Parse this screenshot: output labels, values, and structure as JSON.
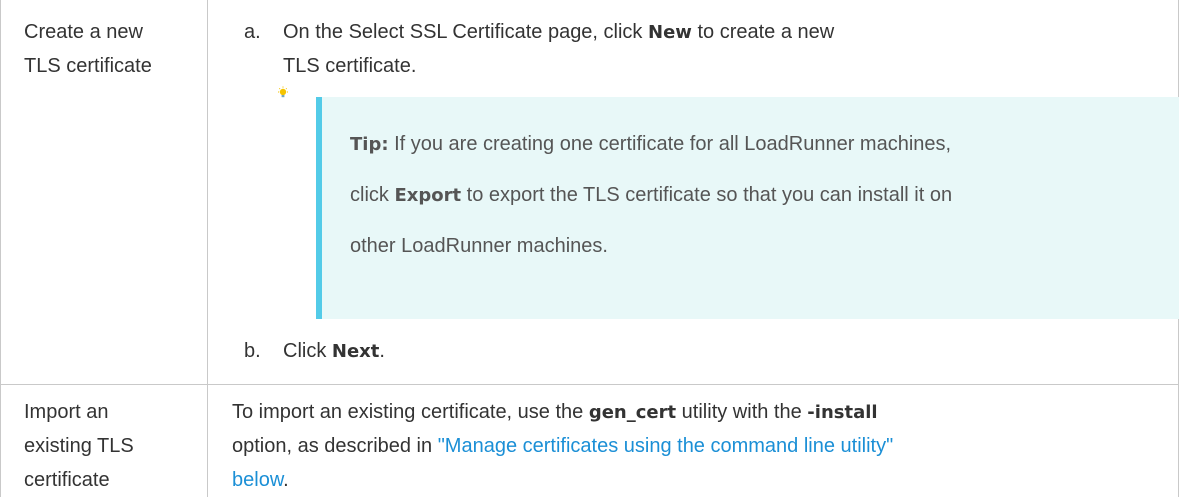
{
  "rows": [
    {
      "label_lines": [
        "Create a new",
        "TLS certificate"
      ],
      "steps": [
        {
          "letter": "a.",
          "line1_pre": "On the Select SSL Certificate page, click ",
          "line1_bold": "New",
          "line1_post": " to create a new",
          "line2": "TLS certificate."
        },
        {
          "letter": "b.",
          "pre": "Click ",
          "bold": "Next",
          "post": "."
        }
      ],
      "tip": {
        "icon": "lightbulb-icon",
        "label": "Tip:",
        "line1": " If you are creating one certificate for all LoadRunner machines,",
        "line2_pre": "click ",
        "line2_bold": "Export",
        "line2_post": " to export the TLS certificate so that you can install it on",
        "line3": "other LoadRunner machines."
      }
    },
    {
      "label_lines": [
        "Import an",
        "existing TLS",
        "certificate"
      ],
      "text": {
        "line1_pre": "To import an existing certificate, use the ",
        "line1_bold1": "gen_cert",
        "line1_mid": " utility with the ",
        "line1_bold2": "-install",
        "line2_pre": "option, as described in ",
        "line2_link": "\"Manage certificates using the command line utility\"",
        "line3_link": "below",
        "line3_post": "."
      }
    }
  ],
  "colors": {
    "border": "#c9c9c9",
    "tip_background": "#e8f8f8",
    "tip_accent": "#53cbe8",
    "link": "#1b8fd6",
    "bulb": "#f5c400"
  }
}
